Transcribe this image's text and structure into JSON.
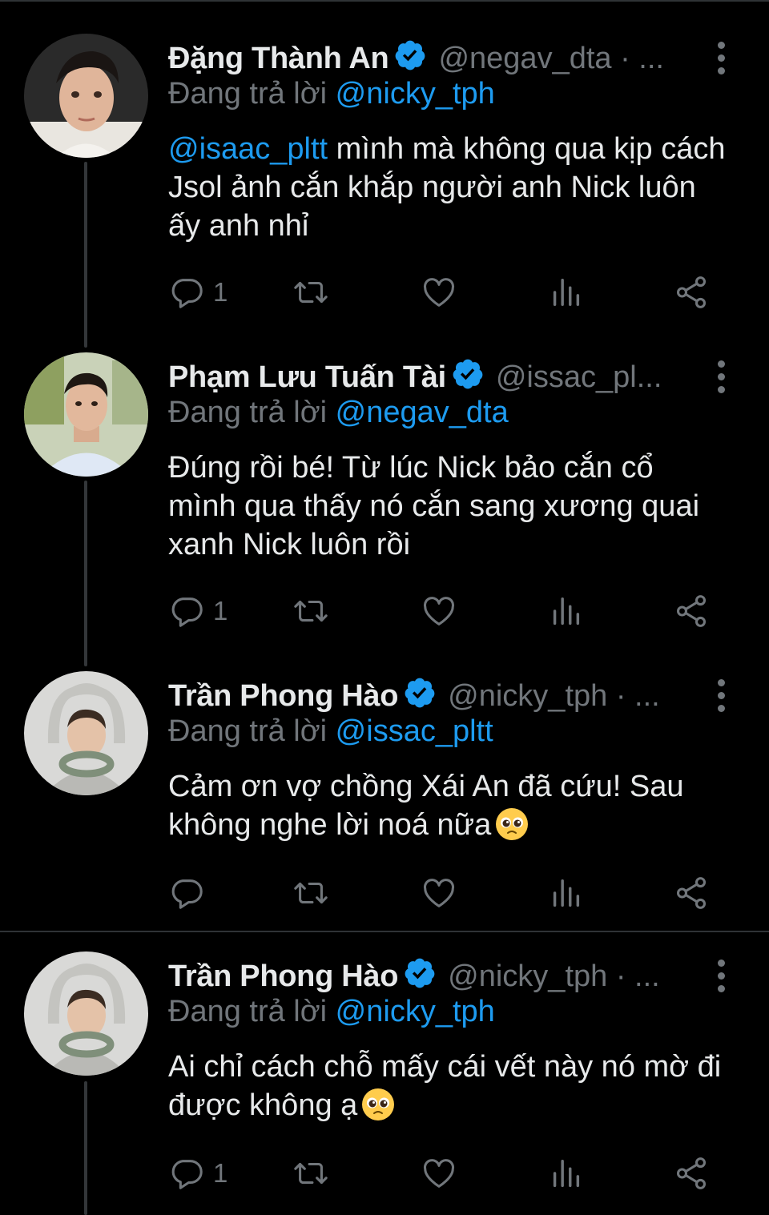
{
  "tweets": [
    {
      "name": "Đặng Thành An",
      "handle": "@negav_dta · ...",
      "reply_prefix": "Đang trả lời",
      "reply_to": "@nicky_tph",
      "mention": "@isaac_pltt",
      "text": " mình mà không qua kịp cách Jsol ảnh cắn khắp người anh Nick luôn ấy anh nhỉ",
      "reply_count": "1",
      "emoji": ""
    },
    {
      "name": "Phạm Lưu Tuấn Tài",
      "handle": "@issac_pl...",
      "reply_prefix": "Đang trả lời",
      "reply_to": "@negav_dta",
      "mention": "",
      "text": "Đúng rồi bé! Từ lúc Nick bảo cắn cổ mình qua thấy nó cắn sang xương quai xanh Nick luôn rồi",
      "reply_count": "1",
      "emoji": ""
    },
    {
      "name": "Trần Phong Hào",
      "handle": "@nicky_tph · ...",
      "reply_prefix": "Đang trả lời",
      "reply_to": "@issac_pltt",
      "mention": "",
      "text": "Cảm ơn vợ chồng Xái An đã cứu! Sau không nghe lời noá nữa",
      "reply_count": "",
      "emoji": "pleading-face"
    },
    {
      "name": "Trần Phong Hào",
      "handle": "@nicky_tph · ...",
      "reply_prefix": "Đang trả lời",
      "reply_to": "@nicky_tph",
      "mention": "",
      "text": "Ai chỉ cách chỗ mấy cái vết này nó mờ đi được không ạ",
      "reply_count": "1",
      "emoji": "pleading-face"
    }
  ],
  "icons": {
    "reply": "speech-bubble-icon",
    "retweet": "retweet-icon",
    "like": "heart-icon",
    "views": "bar-chart-icon",
    "share": "share-icon",
    "verified": "verified-badge-icon",
    "more": "more-vertical-icon"
  },
  "colors": {
    "background": "#000000",
    "text": "#e7e9ea",
    "secondary": "#71767b",
    "link": "#1d9bf0",
    "verified": "#1d9bf0"
  }
}
